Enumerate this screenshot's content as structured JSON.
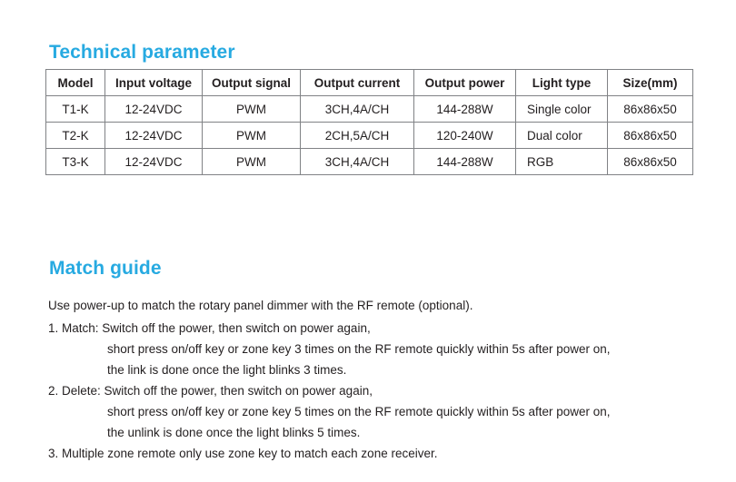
{
  "colors": {
    "heading_blue": "#27aae1",
    "body_text": "#231f20",
    "table_border_inner": "#808285",
    "table_border_outer": "#58595b",
    "background": "#ffffff"
  },
  "sections": {
    "technical": {
      "heading": "Technical parameter",
      "table": {
        "columns": [
          "Model",
          "Input voltage",
          "Output signal",
          "Output current",
          "Output power",
          "Light type",
          "Size(mm)"
        ],
        "rows": [
          {
            "model": "T1-K",
            "input_voltage": "12-24VDC",
            "output_signal": "PWM",
            "output_current": "3CH,4A/CH",
            "output_power": "144-288W",
            "light_type": "Single color",
            "size": "86x86x50"
          },
          {
            "model": "T2-K",
            "input_voltage": "12-24VDC",
            "output_signal": "PWM",
            "output_current": "2CH,5A/CH",
            "output_power": "120-240W",
            "light_type": "Dual color",
            "size": "86x86x50"
          },
          {
            "model": "T3-K",
            "input_voltage": "12-24VDC",
            "output_signal": "PWM",
            "output_current": "3CH,4A/CH",
            "output_power": "144-288W",
            "light_type": "RGB",
            "size": "86x86x50"
          }
        ]
      }
    },
    "match_guide": {
      "heading": "Match guide",
      "intro": "Use power-up to match the rotary panel dimmer with the RF remote (optional).",
      "steps": [
        {
          "lead": "1. Match: Switch off the power, then switch on power again,",
          "cont1": "short press on/off key or zone key 3 times on the RF remote quickly within 5s after power on,",
          "cont2": "the link is done once the light blinks 3 times."
        },
        {
          "lead": "2. Delete: Switch off the power, then switch on power again,",
          "cont1": "short press on/off key or zone key 5 times on the RF remote quickly within 5s after power on,",
          "cont2": "the unlink is done once the light blinks 5 times."
        },
        {
          "lead": "3. Multiple zone remote only use zone key to match each zone receiver.",
          "cont1": "",
          "cont2": ""
        }
      ]
    }
  }
}
